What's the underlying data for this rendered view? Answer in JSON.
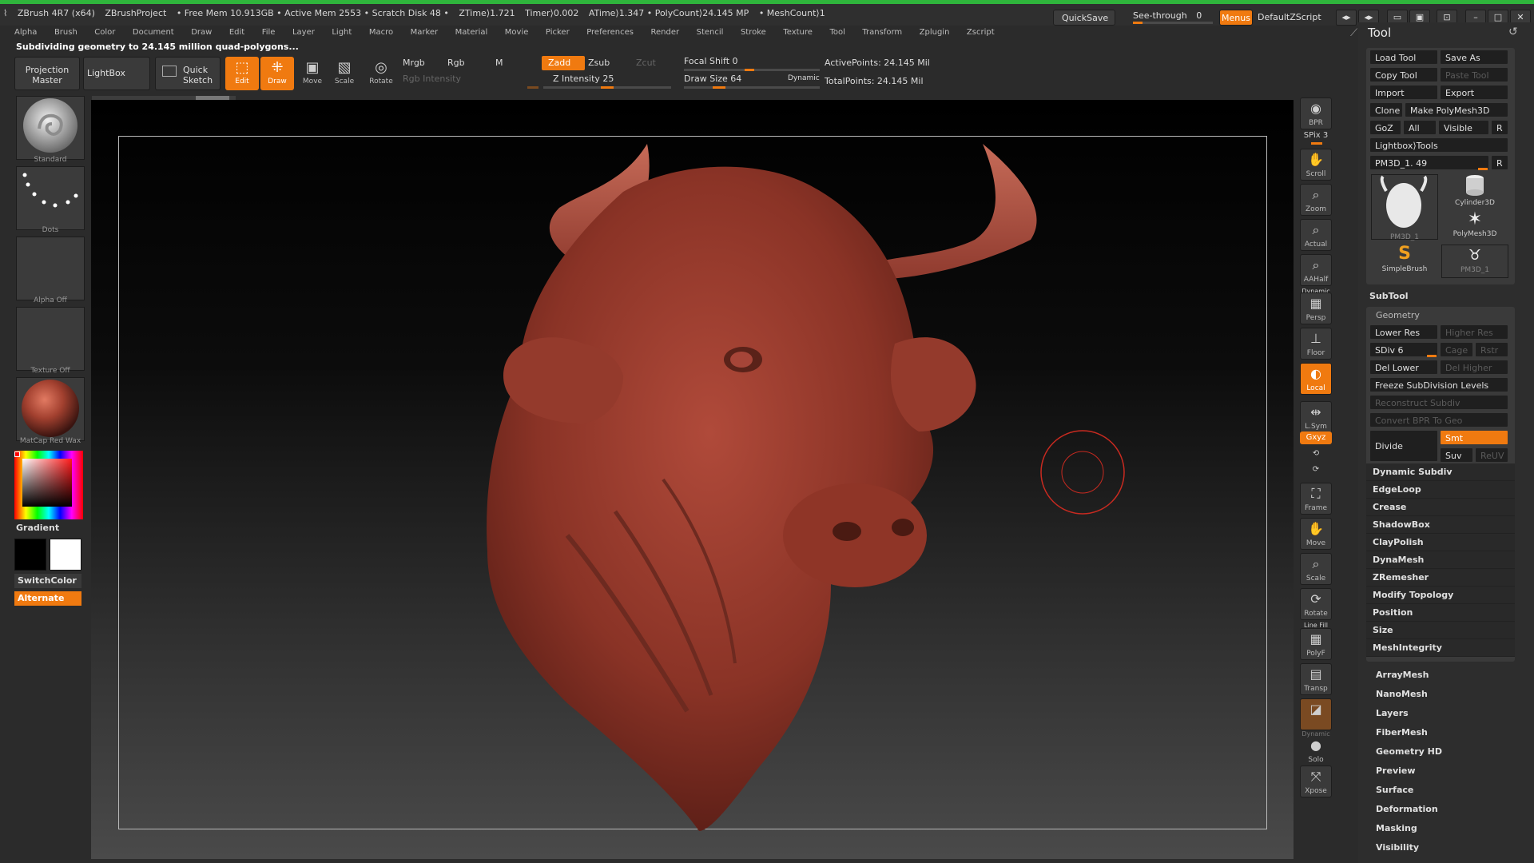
{
  "titlebar": {
    "info": [
      "ZBrush 4R7 (x64)",
      "ZBrushProject",
      "• Free Mem 10.913GB • Active Mem 2553 • Scratch Disk 48 •",
      "ZTime⟩1.721",
      "Timer⟩0.002",
      "ATime⟩1.347 • PolyCount⟩24.145 MP",
      "• MeshCount⟩1"
    ],
    "quicksave": "QuickSave",
    "seethrough": "See-through",
    "seethrough_value": "0",
    "menus": "Menus",
    "script": "DefaultZScript"
  },
  "menu": {
    "items": [
      "Alpha",
      "Brush",
      "Color",
      "Document",
      "Draw",
      "Edit",
      "File",
      "Layer",
      "Light",
      "Macro",
      "Marker",
      "Material",
      "Movie",
      "Picker",
      "Preferences",
      "Render",
      "Stencil",
      "Stroke",
      "Texture",
      "Tool",
      "Transform",
      "Zplugin",
      "Zscript"
    ]
  },
  "status": "Subdividing geometry to 24.145 million quad-polygons...",
  "toolbar": {
    "projection_master": "Projection Master",
    "lightbox": "LightBox",
    "quick_sketch": "Quick Sketch",
    "edit": "Edit",
    "draw": "Draw",
    "move": "Move",
    "scale": "Scale",
    "rotate": "Rotate",
    "mrgb": "Mrgb",
    "rgb": "Rgb",
    "m": "M",
    "rgb_intensity": "Rgb Intensity",
    "zadd": "Zadd",
    "zsub": "Zsub",
    "zcut": "Zcut",
    "z_intensity": "Z Intensity 25",
    "focal_shift": "Focal Shift 0",
    "draw_size": "Draw Size 64",
    "dynamic": "Dynamic",
    "active_points": "ActivePoints: 24.145 Mil",
    "total_points": "TotalPoints: 24.145 Mil"
  },
  "left": {
    "brush": "Standard",
    "stroke": "Dots",
    "alpha": "Alpha Off",
    "texture": "Texture Off",
    "material": "MatCap Red Wax",
    "gradient": "Gradient",
    "switchcolor": "SwitchColor",
    "alternate": "Alternate",
    "primary_color": "#000000",
    "secondary_color": "#ffffff"
  },
  "righticons": {
    "bpr": "BPR",
    "spix": "SPix 3",
    "scroll": "Scroll",
    "zoom": "Zoom",
    "actual": "Actual",
    "aahalf": "AAHalf",
    "dynamic": "Dynamic",
    "persp": "Persp",
    "floor": "Floor",
    "local": "Local",
    "lsym": "L.Sym",
    "xyz": "Gxyz",
    "frame": "Frame",
    "move": "Move",
    "scale": "Scale",
    "rotate": "Rotate",
    "linefill": "Line Fill",
    "polyf": "PolyF",
    "transp": "Transp",
    "ghost": "Ghost",
    "dynamic2": "Dynamic",
    "solo": "Solo",
    "xpose": "Xpose"
  },
  "toolpanel": {
    "title": "Tool",
    "load_tool": "Load Tool",
    "save_as": "Save As",
    "copy_tool": "Copy Tool",
    "paste_tool": "Paste Tool",
    "import": "Import",
    "export": "Export",
    "clone": "Clone",
    "make_polymesh": "Make PolyMesh3D",
    "goz": "GoZ",
    "all": "All",
    "visible": "Visible",
    "r": "R",
    "lightbox_tools": "Lightbox⟩Tools",
    "current_tool": "PM3D_1. 49",
    "thumbs": [
      "PM3D_1",
      "Cylinder3D",
      "PolyMesh3D",
      "SimpleBrush",
      "PM3D_1"
    ],
    "subtool": "SubTool",
    "geometry": "Geometry",
    "lower_res": "Lower Res",
    "higher_res": "Higher Res",
    "sdiv": "SDiv 6",
    "cage": "Cage",
    "rstr": "Rstr",
    "del_lower": "Del Lower",
    "del_higher": "Del Higher",
    "freeze": "Freeze SubDivision Levels",
    "reconstruct": "Reconstruct Subdiv",
    "convert_bpr": "Convert BPR To Geo",
    "divide": "Divide",
    "smt": "Smt",
    "suv": "Suv",
    "reluv": "ReUV",
    "geo_items": [
      "Dynamic Subdiv",
      "EdgeLoop",
      "Crease",
      "ShadowBox",
      "ClayPolish",
      "DynaMesh",
      "ZRemesher",
      "Modify Topology",
      "Position",
      "Size",
      "MeshIntegrity"
    ],
    "sub_items": [
      "ArrayMesh",
      "NanoMesh",
      "Layers",
      "FiberMesh",
      "Geometry HD",
      "Preview",
      "Surface",
      "Deformation",
      "Masking",
      "Visibility"
    ]
  },
  "colors": {
    "accent": "#f07a10",
    "model": "#8a3a30",
    "topbar_green": "#2fb53c"
  }
}
